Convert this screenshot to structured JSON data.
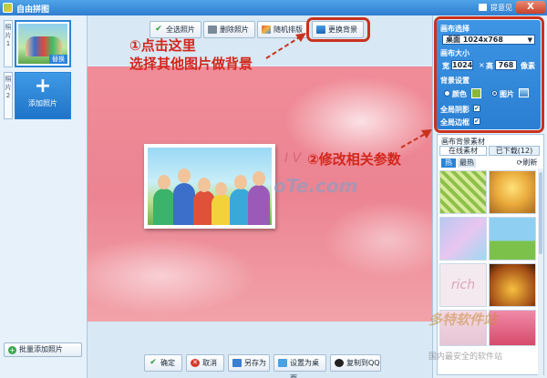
{
  "window": {
    "title": "自由拼图",
    "feedback": "提意见",
    "close_label": "X"
  },
  "left": {
    "photo1_tab": "照片1",
    "photo2_tab": "照片2",
    "replace_badge": "替换",
    "add_photo_label": "添加照片",
    "batch_add_label": "批量添加照片"
  },
  "toolbar": {
    "select_all": "全选照片",
    "delete": "删除照片",
    "random": "随机排版",
    "change_bg": "更换背景"
  },
  "bottombar": {
    "ok": "确定",
    "cancel": "取消",
    "save_as": "另存为",
    "set_desktop": "设置为桌面",
    "copy_qq": "复制到QQ"
  },
  "annotations": {
    "step1_line1": "①点击这里",
    "step1_line2": "选择其他图片做背景",
    "step2": "②修改相关参数"
  },
  "canvas": {
    "watermark": "oTe.com",
    "script_text": "I V"
  },
  "settings": {
    "canvas_select_label": "画布选择",
    "canvas_select_value": "桌面  1024x768",
    "canvas_size_label": "画布大小",
    "width_label": "宽",
    "width_value": "1024",
    "height_label": "高",
    "height_value": "768",
    "unit": "像素",
    "bg_settings_label": "背景设置",
    "color_option": "颜色",
    "image_option": "图片",
    "shadow_label": "全局阴影",
    "border_label": "全局边框",
    "swatch_color": "#8ab83a"
  },
  "material": {
    "title": "画布背景素材",
    "tab_online": "在线素材",
    "tab_downloaded": "已下载(12)",
    "sub_hot": "热",
    "sub_latest": "最热",
    "refresh": "刷新",
    "cell_text": "rich"
  },
  "site": {
    "line1": "多特软件站",
    "line2": "国内最安全的软件站"
  }
}
